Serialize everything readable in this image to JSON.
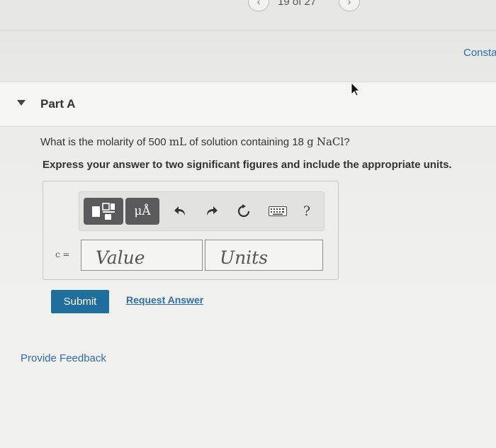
{
  "header": {
    "pager": "19 of 27",
    "constants_link": "Consta"
  },
  "part": {
    "title": "Part A"
  },
  "question": {
    "text_before": "What is the molarity of 500 ",
    "unit_ml": "mL",
    "text_middle": " of solution containing 18 ",
    "unit_g": "g",
    "formula": "NaCl",
    "text_after": "?",
    "instruction": "Express your answer to two significant figures and include the appropriate units."
  },
  "toolbar": {
    "units_label": "μÅ",
    "help_label": "?"
  },
  "answer": {
    "variable_label": "c =",
    "value_placeholder": "Value",
    "units_placeholder": "Units"
  },
  "actions": {
    "submit_label": "Submit",
    "request_label": "Request Answer",
    "feedback_label": "Provide Feedback"
  },
  "colors": {
    "accent": "#1f6e9c",
    "link": "#2f6ea4",
    "toolbar_dark": "#5a5a5c"
  },
  "icons": [
    "chevron-left-icon",
    "chevron-right-icon",
    "caret-down-icon",
    "templates-icon",
    "undo-icon",
    "redo-icon",
    "reset-icon",
    "keyboard-icon",
    "help-icon",
    "mouse-cursor-icon"
  ]
}
